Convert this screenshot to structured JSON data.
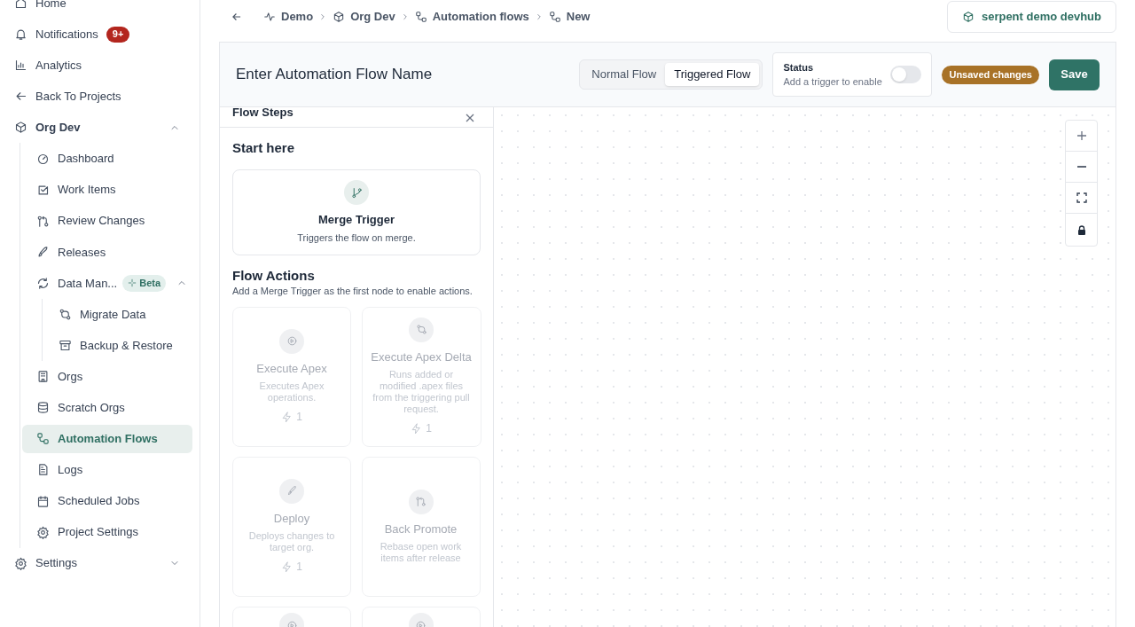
{
  "sidebar": {
    "items": [
      {
        "label": "Home",
        "selected": false
      },
      {
        "label": "Notifications",
        "selected": false,
        "badge": "9+"
      },
      {
        "label": "Analytics",
        "selected": false
      },
      {
        "label": "Back To Projects",
        "selected": false
      },
      {
        "label": "Org Dev",
        "selected": false,
        "expanded": true,
        "children": [
          {
            "label": "Dashboard",
            "selected": false
          },
          {
            "label": "Work Items",
            "selected": false
          },
          {
            "label": "Review Changes",
            "selected": false
          },
          {
            "label": "Releases",
            "selected": false
          },
          {
            "label": "Data Man...",
            "selected": false,
            "badge": "Beta",
            "expanded": true,
            "children": [
              {
                "label": "Migrate Data",
                "selected": false
              },
              {
                "label": "Backup & Restore",
                "selected": false
              }
            ]
          },
          {
            "label": "Orgs",
            "selected": false
          },
          {
            "label": "Scratch Orgs",
            "selected": false
          },
          {
            "label": "Automation Flows",
            "selected": true
          },
          {
            "label": "Logs",
            "selected": false
          },
          {
            "label": "Scheduled Jobs",
            "selected": false
          },
          {
            "label": "Project Settings",
            "selected": false
          }
        ]
      },
      {
        "label": "Settings",
        "selected": false,
        "expanded": false
      }
    ]
  },
  "breadcrumbs": [
    "Demo",
    "Org Dev",
    "Automation flows",
    "New"
  ],
  "org_button": "serpent demo devhub",
  "flow_name": {
    "placeholder": "Enter Automation Flow Name"
  },
  "flow_types": [
    {
      "label": "Normal Flow",
      "selected": false
    },
    {
      "label": "Triggered Flow",
      "selected": true
    }
  ],
  "status": {
    "title": "Status",
    "hint": "Add a trigger to enable",
    "on": false
  },
  "unsaved_badge": "Unsaved changes",
  "save_button": "Save",
  "flow_steps": {
    "title": "Flow Steps",
    "start_title": "Start here",
    "trigger": {
      "title": "Merge Trigger",
      "description": "Triggers the flow on merge.",
      "disabled": false
    },
    "actions_title": "Flow Actions",
    "actions_hint": "Add a Merge Trigger as the first node to enable actions.",
    "actions": [
      {
        "title": "Execute Apex",
        "description": "Executes Apex operations.",
        "count": "1",
        "disabled": true
      },
      {
        "title": "Execute Apex Delta",
        "description": "Runs added or modified .apex files from the triggering pull request.",
        "count": "1",
        "disabled": true
      },
      {
        "title": "Deploy",
        "description": "Deploys changes to target org.",
        "count": "1",
        "disabled": true
      },
      {
        "title": "Back Promote",
        "description": "Rebase open work items after release",
        "disabled": true
      },
      {
        "disabled": true
      },
      {
        "disabled": true
      }
    ]
  }
}
